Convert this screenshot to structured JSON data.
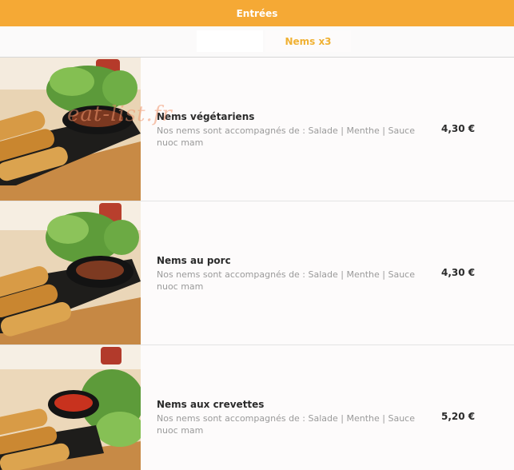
{
  "header": {
    "title": "Entrées"
  },
  "tabs": {
    "active_label": "Nems x3"
  },
  "watermark": "eat-list.fr",
  "items": [
    {
      "name": "Nems végétariens",
      "description": "Nos nems sont accompagnés de : Salade | Menthe | Sauce nuoc mam",
      "price": "4,30 €",
      "image": "spring-rolls-photo"
    },
    {
      "name": "Nems au porc",
      "description": "Nos nems sont accompagnés de : Salade | Menthe | Sauce nuoc mam",
      "price": "4,30 €",
      "image": "spring-rolls-photo"
    },
    {
      "name": "Nems aux crevettes",
      "description": "Nos nems sont accompagnés de : Salade | Menthe | Sauce nuoc mam",
      "price": "5,20 €",
      "image": "spring-rolls-photo"
    }
  ],
  "colors": {
    "accent": "#f5a935",
    "tab_text": "#f0b133"
  }
}
